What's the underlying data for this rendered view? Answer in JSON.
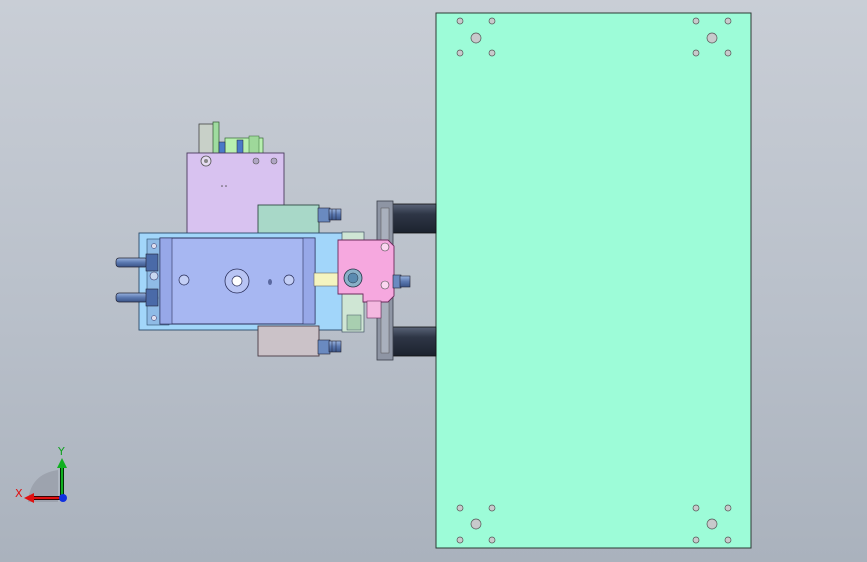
{
  "triad": {
    "x_label": "X",
    "y_label": "Y"
  },
  "colors": {
    "plate": "#9dfcd8",
    "manifold": "#a2d6fa",
    "cylinder": "#a7b7f2",
    "upper_block": "#d8c2f0",
    "end_block": "#f6a8df",
    "valve": "#a8d8c8",
    "lower_block": "#cbc2c8",
    "x_axis": "#e01010",
    "y_axis": "#10b020",
    "z_axis": "#1030e0"
  }
}
